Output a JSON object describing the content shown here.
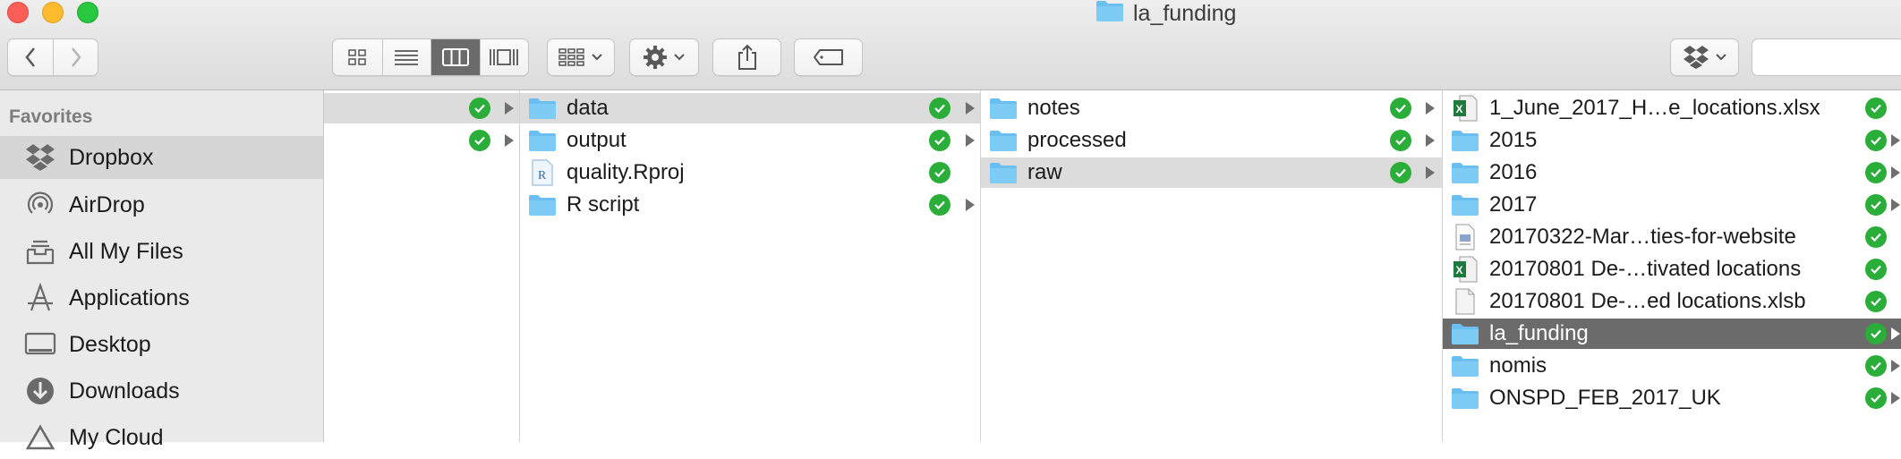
{
  "window": {
    "title": "la_funding"
  },
  "toolbar": {
    "view_modes": [
      "icon-view",
      "list-view",
      "column-view",
      "gallery-view"
    ],
    "active_view": "column-view"
  },
  "sidebar": {
    "heading": "Favorites",
    "items": [
      {
        "label": "Dropbox",
        "icon": "dropbox-icon",
        "active": true
      },
      {
        "label": "AirDrop",
        "icon": "airdrop-icon"
      },
      {
        "label": "All My Files",
        "icon": "all-files-icon"
      },
      {
        "label": "Applications",
        "icon": "applications-icon"
      },
      {
        "label": "Desktop",
        "icon": "desktop-icon"
      },
      {
        "label": "Downloads",
        "icon": "downloads-icon"
      },
      {
        "label": "My Cloud",
        "icon": "cloud-icon"
      }
    ]
  },
  "columns": [
    {
      "rows": [
        {
          "label": "",
          "selected": true
        },
        {
          "label": ""
        }
      ]
    },
    {
      "rows": [
        {
          "label": "data",
          "kind": "folder",
          "selected": true
        },
        {
          "label": "output",
          "kind": "folder"
        },
        {
          "label": "quality.Rproj",
          "kind": "rproj"
        },
        {
          "label": "R script",
          "kind": "folder"
        }
      ]
    },
    {
      "rows": [
        {
          "label": "notes",
          "kind": "folder"
        },
        {
          "label": "processed",
          "kind": "folder"
        },
        {
          "label": "raw",
          "kind": "folder",
          "selected": true
        }
      ]
    },
    {
      "rows": [
        {
          "label": "1_June_2017_H…e_locations.xlsx",
          "kind": "excel"
        },
        {
          "label": "2015",
          "kind": "folder"
        },
        {
          "label": "2016",
          "kind": "folder"
        },
        {
          "label": "2017",
          "kind": "folder"
        },
        {
          "label": "20170322-Mar…ties-for-website",
          "kind": "document"
        },
        {
          "label": "20170801 De-…tivated locations",
          "kind": "excel"
        },
        {
          "label": "20170801 De-…ed locations.xlsb",
          "kind": "generic"
        },
        {
          "label": "la_funding",
          "kind": "folder",
          "selected": true
        },
        {
          "label": "nomis",
          "kind": "folder"
        },
        {
          "label": "ONSPD_FEB_2017_UK",
          "kind": "folder"
        }
      ]
    }
  ],
  "colors": {
    "folder": "#6bbff0",
    "synced": "#2bae39",
    "selection": "#6b6b6b"
  }
}
